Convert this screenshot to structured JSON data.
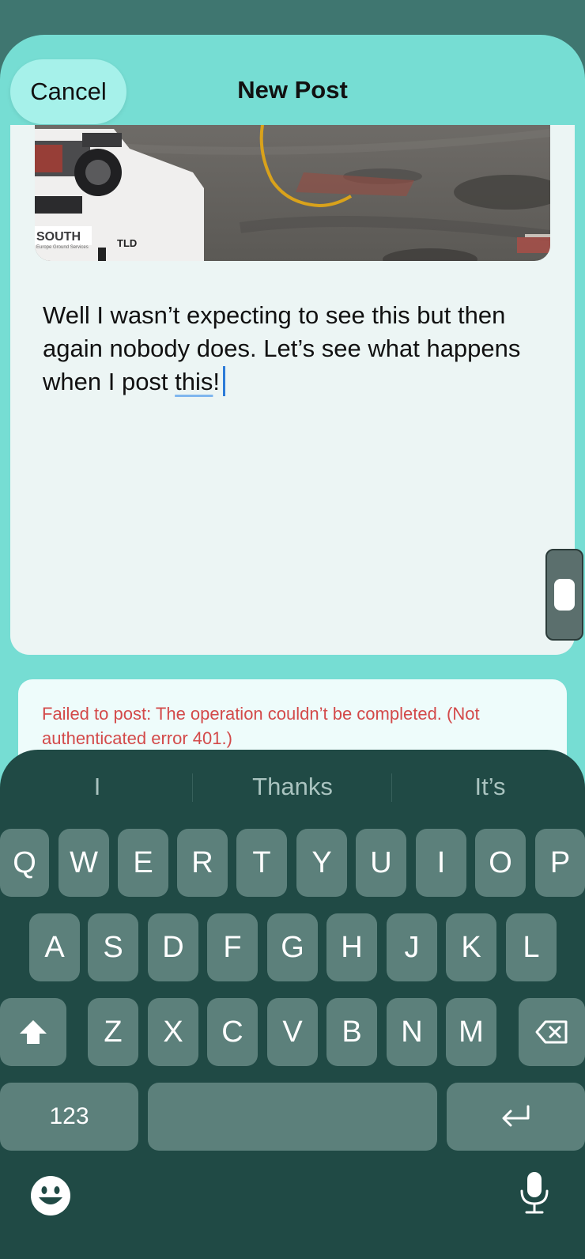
{
  "nav": {
    "cancel_label": "Cancel",
    "title": "New Post"
  },
  "photo": {
    "truck_brand": "SOUTH",
    "truck_sub": "Europe Ground Services",
    "vehicle_mark": "TLD"
  },
  "post": {
    "text_before": "Well I wasn’t expecting to see this but then again nobody does. Let’s see what happens when I post ",
    "underlined_word": "this",
    "text_after": "!"
  },
  "error": {
    "message": "Failed to post: The operation couldn’t be completed. (Not authenticated error 401.)"
  },
  "keyboard": {
    "suggestions": [
      "I",
      "Thanks",
      "It’s"
    ],
    "row1": [
      "Q",
      "W",
      "E",
      "R",
      "T",
      "Y",
      "U",
      "I",
      "O",
      "P"
    ],
    "row2": [
      "A",
      "S",
      "D",
      "F",
      "G",
      "H",
      "J",
      "K",
      "L"
    ],
    "row3": [
      "Z",
      "X",
      "C",
      "V",
      "B",
      "N",
      "M"
    ],
    "numbers_label": "123",
    "shift_icon": "shift-icon",
    "delete_icon": "backspace-icon",
    "return_icon": "return-icon",
    "emoji_icon": "emoji-icon",
    "mic_icon": "microphone-icon"
  },
  "colors": {
    "sheet": "#76ddd3",
    "error_text": "#d34a4a",
    "keyboard_bg": "#204a45",
    "key_bg": "#5c807b"
  }
}
